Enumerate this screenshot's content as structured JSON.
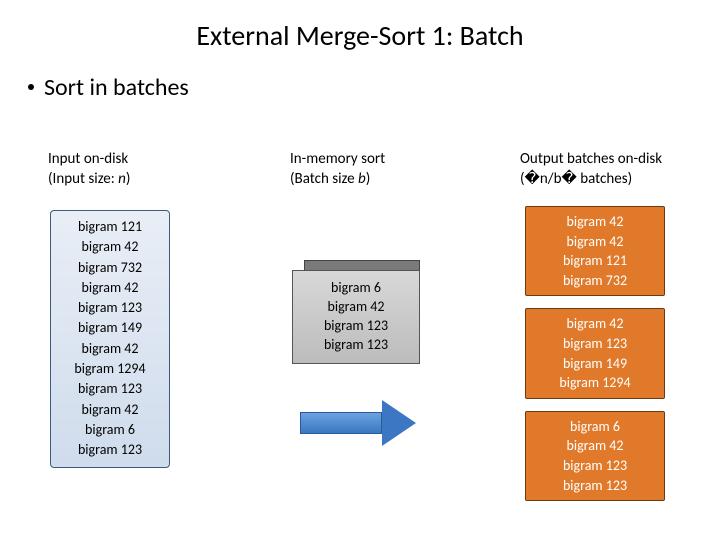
{
  "title": "External Merge-Sort 1: Batch",
  "bullet": "Sort in batches",
  "col1": {
    "h1": "Input on-disk",
    "h2a": "(Input size: ",
    "h2n": "n",
    "h2b": ")"
  },
  "col2": {
    "h1": "In-memory sort",
    "h2a": "(Batch size ",
    "h2b": "b",
    "h2c": ")"
  },
  "col3": {
    "h1": "Output batches on-disk",
    "h2": "(�n/b� batches)"
  },
  "input_items": [
    "bigram 121",
    "bigram 42",
    "bigram 732",
    "bigram 42",
    "bigram 123",
    "bigram 149",
    "bigram 42",
    "bigram 1294",
    "bigram 123",
    "bigram 42",
    "bigram 6",
    "bigram 123"
  ],
  "mem_items": [
    "bigram 6",
    "bigram 42",
    "bigram 123",
    "bigram 123"
  ],
  "out_batches": [
    [
      "bigram 42",
      "bigram 42",
      "bigram 121",
      "bigram 732"
    ],
    [
      "bigram 42",
      "bigram 123",
      "bigram 149",
      "bigram 1294"
    ],
    [
      "bigram 6",
      "bigram 42",
      "bigram 123",
      "bigram 123"
    ]
  ]
}
